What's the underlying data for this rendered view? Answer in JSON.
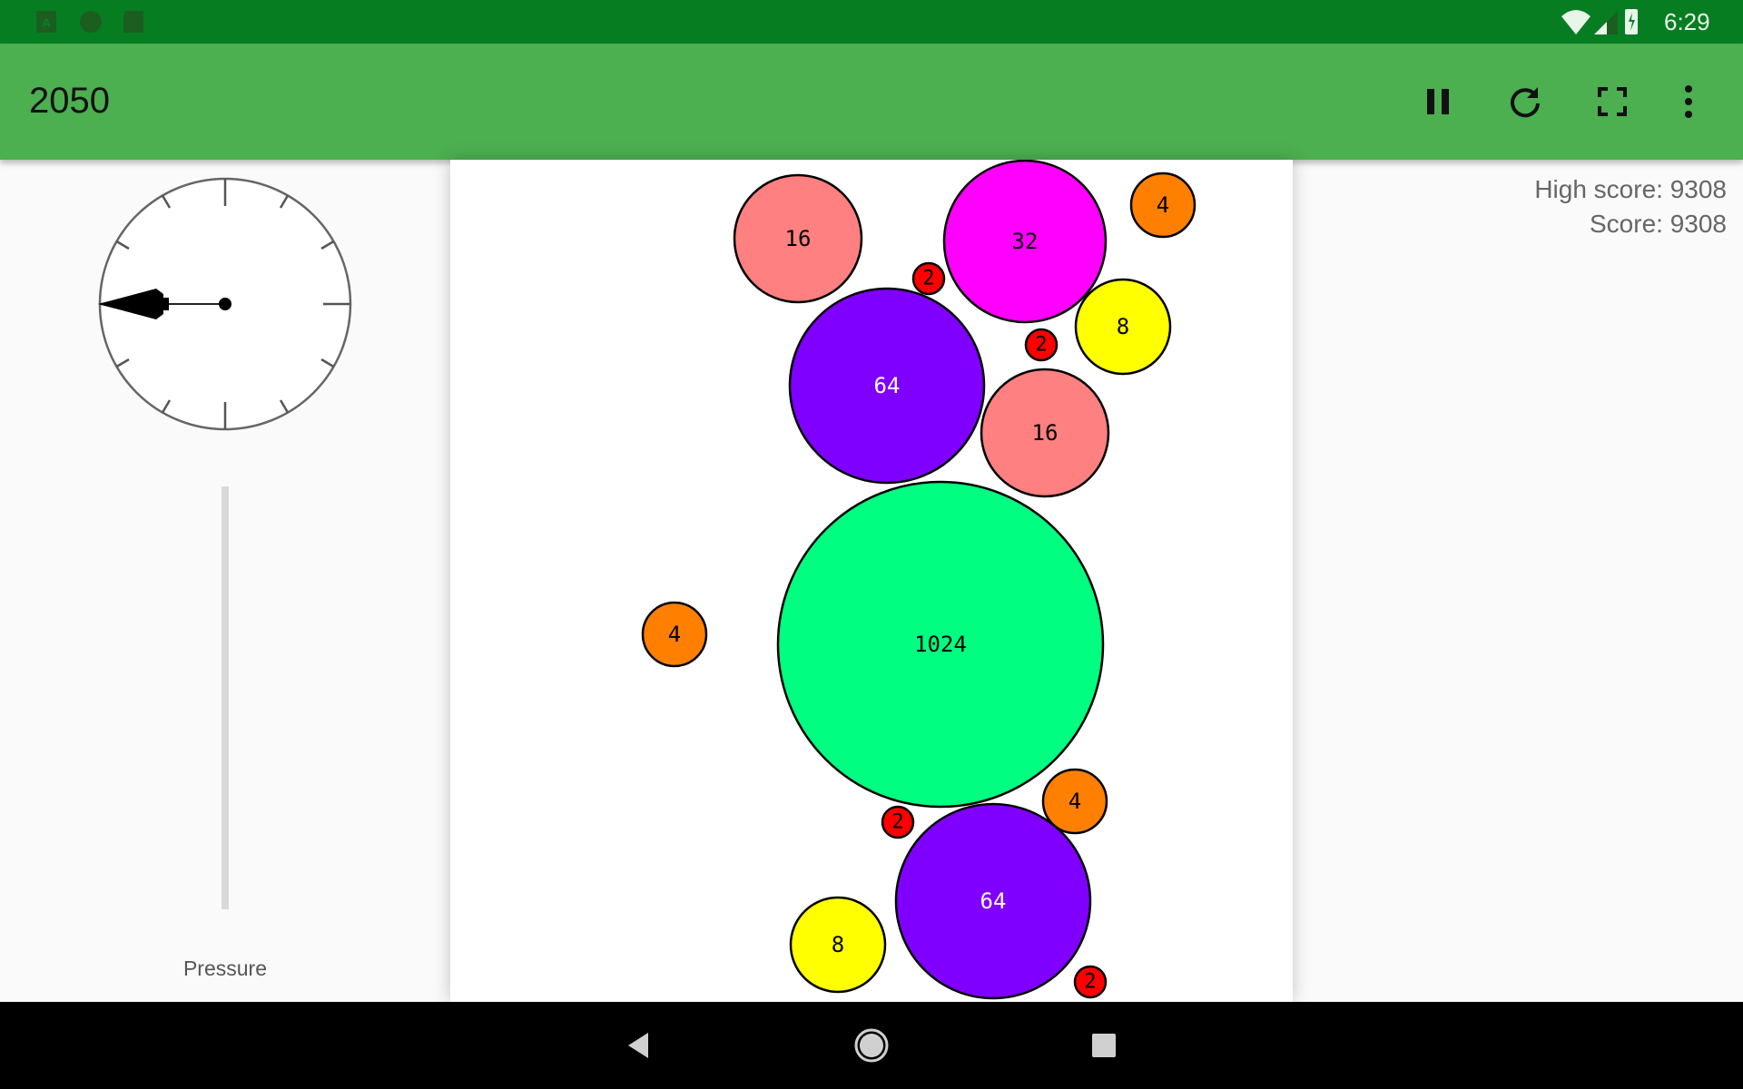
{
  "status_bar": {
    "time": "6:29",
    "left_icons": [
      "app-store-icon",
      "circle-notification-icon",
      "sd-card-icon"
    ],
    "right_icons": [
      "wifi-icon",
      "cellular-signal-icon",
      "battery-charging-icon"
    ]
  },
  "app_bar": {
    "title": "2050",
    "actions": [
      "pause-icon",
      "restart-icon",
      "fullscreen-icon",
      "more-vert-icon"
    ],
    "color": "#4caf50"
  },
  "left_panel": {
    "gauge_icon": "gravity-direction-dial",
    "pressure_label": "Pressure",
    "pressure_level": 0
  },
  "scores": {
    "high_score": "High score: 9308",
    "score": "Score: 9308"
  },
  "board": {
    "bubbles": [
      {
        "value": "16",
        "color": "#ff8080",
        "text_color": "#000000"
      },
      {
        "value": "32",
        "color": "#ff00ff",
        "text_color": "#000000"
      },
      {
        "value": "4",
        "color": "#ff8000",
        "text_color": "#000000"
      },
      {
        "value": "2",
        "color": "#ff0000",
        "text_color": "#000000"
      },
      {
        "value": "8",
        "color": "#ffff00",
        "text_color": "#000000"
      },
      {
        "value": "2",
        "color": "#ff0000",
        "text_color": "#000000"
      },
      {
        "value": "64",
        "color": "#8000ff",
        "text_color": "#ffffff"
      },
      {
        "value": "16",
        "color": "#ff8080",
        "text_color": "#000000"
      },
      {
        "value": "1024",
        "color": "#00ff80",
        "text_color": "#000000"
      },
      {
        "value": "4",
        "color": "#ff8000",
        "text_color": "#000000"
      },
      {
        "value": "4",
        "color": "#ff8000",
        "text_color": "#000000"
      },
      {
        "value": "2",
        "color": "#ff0000",
        "text_color": "#000000"
      },
      {
        "value": "64",
        "color": "#8000ff",
        "text_color": "#ffffff"
      },
      {
        "value": "8",
        "color": "#ffff00",
        "text_color": "#000000"
      },
      {
        "value": "2",
        "color": "#ff0000",
        "text_color": "#000000"
      }
    ]
  },
  "nav_bar": {
    "buttons": [
      "back-icon",
      "home-icon",
      "recents-icon"
    ]
  }
}
